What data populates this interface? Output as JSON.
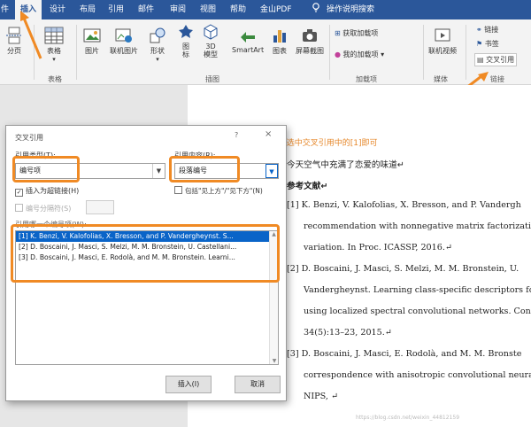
{
  "tabs": [
    "件",
    "插入",
    "设计",
    "布局",
    "引用",
    "邮件",
    "审阅",
    "视图",
    "帮助",
    "金山PDF",
    "操作说明搜索"
  ],
  "active_tab_index": 1,
  "ribbon": {
    "page_label": "分页",
    "table_label": "表格",
    "table_group": "表格",
    "picture": "图片",
    "online_picture": "联机图片",
    "shapes": "形状",
    "icons": "图\n标",
    "model3d": "3D\n模型",
    "smartart": "SmartArt",
    "chart": "图表",
    "screenshot": "屏幕截图",
    "illustrations_group": "插图",
    "get_addins": "获取加载项",
    "my_addins": "我的加载项",
    "addins_group": "加载项",
    "online_video": "联机视频",
    "media_group": "媒体",
    "link": "链接",
    "bookmark": "书签",
    "cross_ref": "交叉引用",
    "links_group": "链接"
  },
  "dialog": {
    "title": "交叉引用",
    "help": "?",
    "close": "×",
    "ref_type_label": "引用类型(T):",
    "ref_type_value": "编号项",
    "ref_content_label": "引用内容(R):",
    "ref_content_value": "段落编号",
    "insert_as_link": "插入为超链接(H)",
    "include_above_below": "包括\"见上方\"/\"见下方\"(N)",
    "separate_numbers": "编号分隔符(S)",
    "which_item_label": "引用哪一个编号项(W):",
    "items": [
      "[1] K. Benzi, V. Kalofolias, X. Bresson, and P. Vandergheynst. S...",
      "[2] D. Boscaini, J. Masci, S. Melzi, M. M. Bronstein, U. Castellani...",
      "[3] D. Boscaini, J. Masci, E. Rodolà, and M. M. Bronstein. Learni..."
    ],
    "insert_button": "插入(I)",
    "cancel_button": "取消"
  },
  "annotation": "假如我要在恋爱后插入[1]，选中交叉引用中的[1]即可",
  "document": {
    "line1": "今天空气中充满了恋爱的味道↵",
    "refs_heading": "参考文献↵",
    "r1a": "[1]  K. Benzi, V. Kalofolias, X. Bresson, and P. Vandergh",
    "r1b": "recommendation with nonnegative matrix factorizatio",
    "r1c": "variation. In Proc. ICASSP, 2016.↵",
    "r2a": "[2]  D. Boscaini, J. Masci, S. Melzi, M. M. Bronstein, U.",
    "r2b": "Vandergheynst. Learning class-specific descriptors fo",
    "r2c": "using localized spectral convolutional networks. Con",
    "r2d": "34(5):13–23, 2015.↵",
    "r3a": "[3]  D. Boscaini, J. Masci, E. Rodolà, and M. M. Bronste",
    "r3b": "correspondence with anisotropic convolutional neura",
    "r3c": "NIPS, ↵"
  },
  "watermark": "https://blog.csdn.net/weixin_44812159",
  "colors": {
    "accent": "#2b579a",
    "highlight": "#f08a24",
    "selection": "#0a64c8"
  }
}
